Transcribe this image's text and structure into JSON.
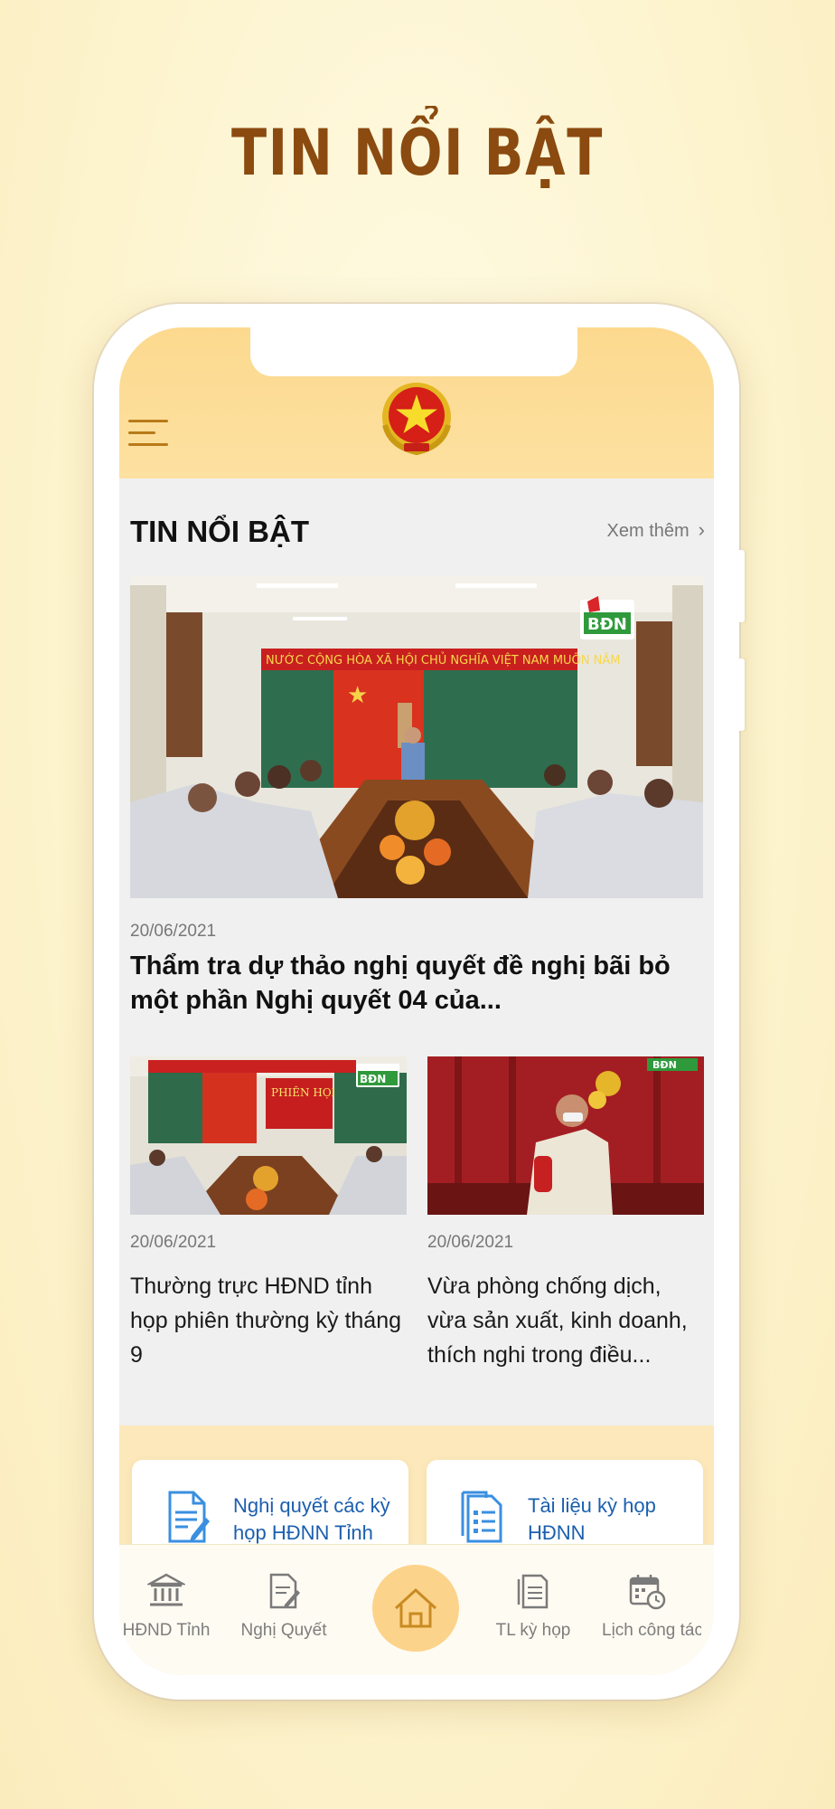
{
  "promo": {
    "title": "TIN  NỔI BẬT"
  },
  "header": {
    "menu_icon": "hamburger-menu-icon",
    "emblem": "vietnam-national-emblem"
  },
  "section": {
    "title": "TIN NỔI BẬT",
    "see_more": "Xem thêm"
  },
  "hero": {
    "date": "20/06/2021",
    "title": "Thẩm tra dự thảo nghị quyết đề nghị bãi bỏ một phần Nghị quyết 04 của...",
    "image_banner": "NƯỚC CỘNG HÒA XÃ HỘI CHỦ NGHĨA VIỆT NAM MUÔN NĂM",
    "logo": "BĐN"
  },
  "cards": [
    {
      "date": "20/06/2021",
      "title": "Thường trực HĐND tỉnh họp phiên thường kỳ tháng 9",
      "sign_text": "PHIÊN HỌP",
      "logo": "BĐN"
    },
    {
      "date": "20/06/2021",
      "title": "Vừa phòng chống dịch, vừa sản xuất, kinh doanh, thích nghi trong điều...",
      "logo": "BĐN"
    }
  ],
  "quick_links": [
    {
      "label": "Nghị quyết các kỳ họp HĐNN Tỉnh",
      "icon": "document-pen-icon"
    },
    {
      "label": "Tài liệu kỳ họp HĐNN",
      "icon": "document-list-icon"
    }
  ],
  "tabbar": {
    "items": [
      {
        "label": "HĐND Tỉnh",
        "icon": "government-building-icon"
      },
      {
        "label": "Nghị Quyết",
        "icon": "resolution-document-icon"
      },
      {
        "label": "Trang chủ",
        "icon": "home-icon"
      },
      {
        "label": "TL kỳ họp",
        "icon": "meeting-documents-icon"
      },
      {
        "label": "Lịch công tác",
        "icon": "calendar-clock-icon"
      }
    ]
  },
  "colors": {
    "accent": "#fcd38a",
    "link": "#1b5fae",
    "title_brown": "#8a4a10"
  }
}
